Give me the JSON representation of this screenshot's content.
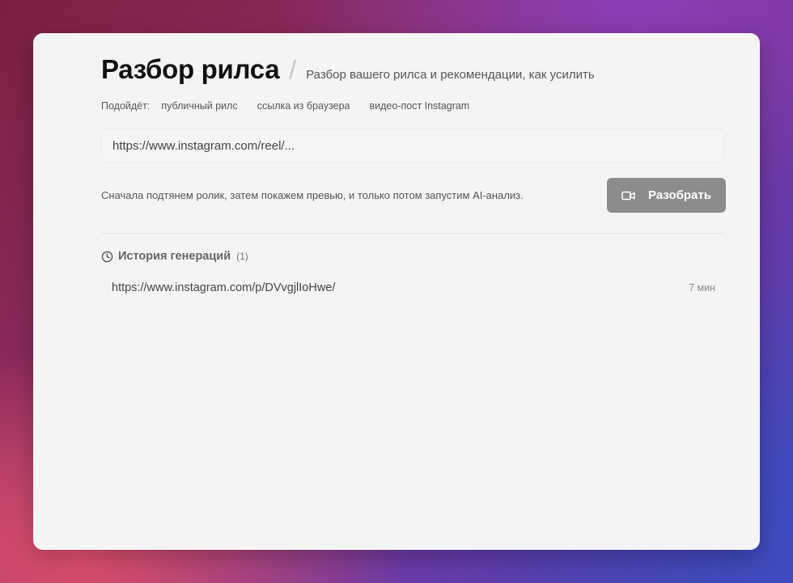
{
  "header": {
    "title": "Разбор рилса",
    "separator": "/",
    "subtitle": "Разбор вашего рилса и рекомендации, как усилить"
  },
  "fits": {
    "label": "Подойдёт:",
    "tags": [
      "публичный рилс",
      "ссылка из браузера",
      "видео-пост Instagram"
    ]
  },
  "input": {
    "value": "",
    "placeholder": "https://www.instagram.com/reel/..."
  },
  "note": "Сначала подтянем ролик, затем покажем превью, и только потом запустим AI-анализ.",
  "action": {
    "label": "Разобрать",
    "icon": "video-camera-icon",
    "color": "#8c8c8c"
  },
  "history": {
    "title": "История генераций",
    "count": "(1)",
    "icon": "clock-icon",
    "items": [
      {
        "url": "https://www.instagram.com/p/DVvgjlIoHwe/",
        "time": "7 мин"
      }
    ]
  }
}
